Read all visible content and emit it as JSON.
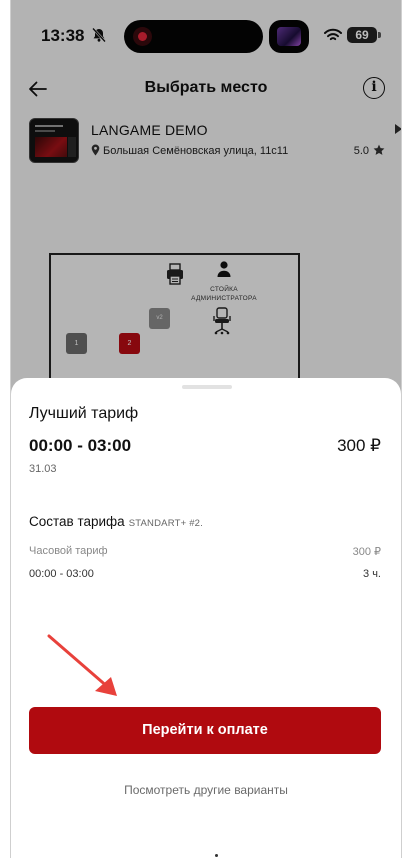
{
  "status_bar": {
    "time": "13:38",
    "battery": "69"
  },
  "header": {
    "title": "Выбрать место",
    "info_glyph": "i"
  },
  "club": {
    "name": "LANGAME DEMO",
    "address": "Большая Семёновская улица, 11с11",
    "rating": "5.0"
  },
  "map": {
    "seats": [
      "1",
      "2",
      "v2"
    ],
    "admin_label": "СТОЙКА АДМИНИСТРАТОРА"
  },
  "tariff": {
    "best_title": "Лучший тариф",
    "time_range": "00:00 - 03:00",
    "price": "300 ₽",
    "date": "31.03",
    "composition_title": "Состав тарифа",
    "composition_name": "STANDART+ #2.",
    "rows": [
      {
        "label": "Часовой тариф",
        "value": "300 ₽"
      },
      {
        "label": "00:00 - 03:00",
        "value": "3 ч."
      }
    ],
    "pay_button": "Перейти к оплате",
    "other_link": "Посмотреть другие варианты"
  },
  "colors": {
    "accent": "#b00a0f",
    "seat_selected": "#b60b13",
    "seat_default": "#6b6b6b",
    "pointer": "#e8413b"
  },
  "icons": [
    "bell-slash-icon",
    "record-icon",
    "wifi-icon",
    "back-arrow-icon",
    "info-icon",
    "location-pin-icon",
    "star-icon",
    "printer-icon",
    "person-icon",
    "office-chair-icon",
    "pointer-arrow-icon"
  ]
}
